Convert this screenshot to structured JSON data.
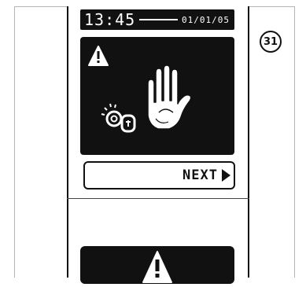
{
  "status_bar": {
    "time": "13:45",
    "date": "01/01/05"
  },
  "figure_number": "31",
  "warning_panel": {
    "icons": [
      "warning-triangle-icon",
      "stop-hand-icon",
      "key-unlock-icon"
    ]
  },
  "next_button": {
    "label": "NEXT"
  },
  "bottom_panel": {
    "icons": [
      "warning-triangle-icon"
    ]
  },
  "colors": {
    "display": "#111111",
    "background": "#ffffff",
    "frame": "#b4b4b4"
  }
}
